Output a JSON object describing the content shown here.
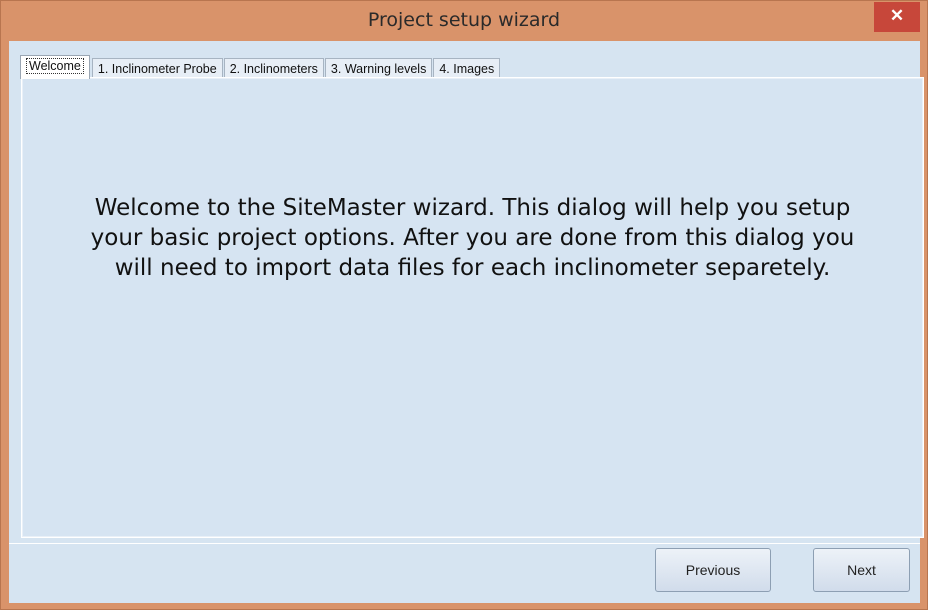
{
  "window": {
    "title": "Project setup wizard",
    "close_glyph": "✕"
  },
  "tabs": [
    {
      "label": "Welcome",
      "active": true
    },
    {
      "label": "1. Inclinometer Probe",
      "active": false
    },
    {
      "label": "2. Inclinometers",
      "active": false
    },
    {
      "label": "3. Warning levels",
      "active": false
    },
    {
      "label": "4. Images",
      "active": false
    }
  ],
  "welcome": {
    "message": "Welcome to the SiteMaster wizard. This dialog will help you setup your basic project options. After you are done from this dialog you will need to import data files for each inclinometer separetely."
  },
  "buttons": {
    "previous_label": "Previous",
    "next_label": "Next"
  },
  "colors": {
    "window_frame": "#d9936a",
    "close_button": "#c7473a",
    "client_background": "#d6e4f1"
  }
}
